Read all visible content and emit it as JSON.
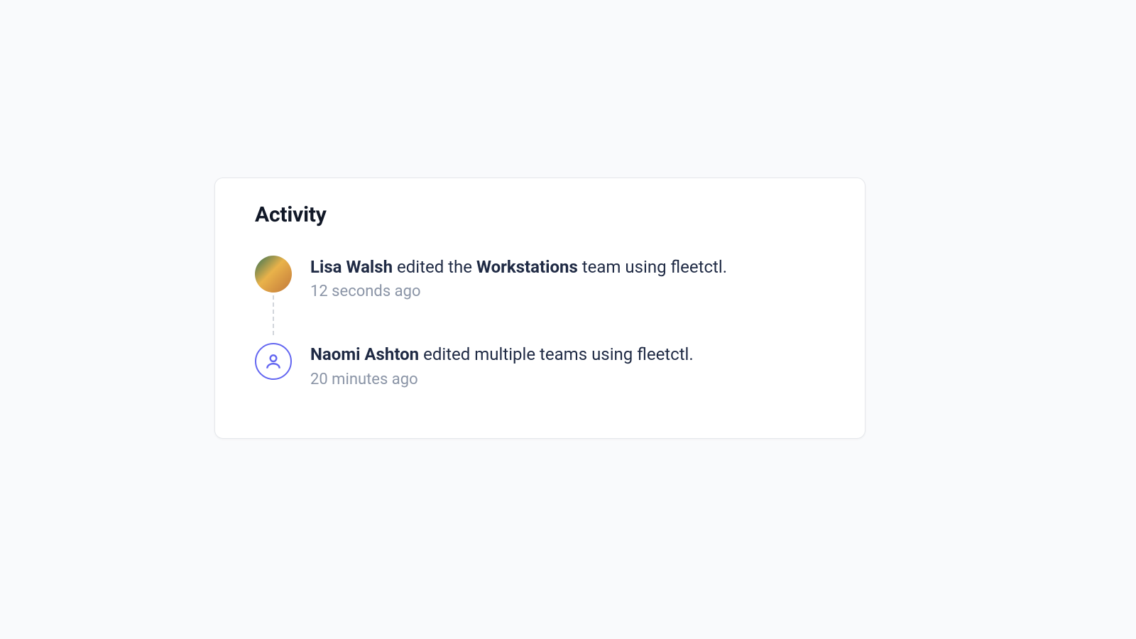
{
  "card": {
    "title": "Activity"
  },
  "feed": [
    {
      "avatar_kind": "photo",
      "actor": "Lisa Walsh",
      "verb_pre": " edited the ",
      "object": "Workstations",
      "verb_post": " team using fleetctl.",
      "time": "12 seconds ago"
    },
    {
      "avatar_kind": "placeholder",
      "actor": "Naomi Ashton",
      "verb_pre": " edited multiple teams using fleetctl.",
      "object": "",
      "verb_post": "",
      "time": "20 minutes ago"
    }
  ]
}
